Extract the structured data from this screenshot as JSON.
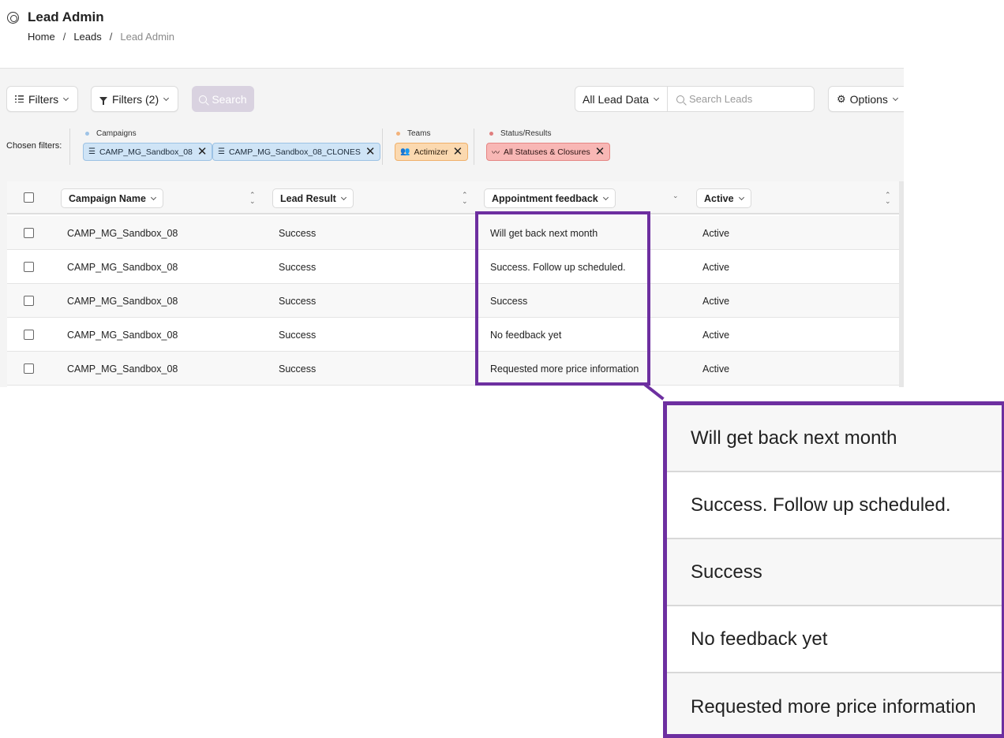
{
  "header": {
    "title": "Lead Admin",
    "breadcrumb": [
      "Home",
      "Leads",
      "Lead Admin"
    ],
    "breadcrumb_separator": "/"
  },
  "toolbar": {
    "filters_label": "Filters",
    "filters_count_label": "Filters (2)",
    "search_button_label": "Search",
    "data_scope_label": "All Lead Data",
    "search_placeholder": "Search Leads",
    "options_label": "Options"
  },
  "chosen_filters": {
    "label": "Chosen filters:",
    "groups": [
      {
        "title": "Campaigns",
        "dot_color": "#9ec3e6",
        "chips": [
          "CAMP_MG_Sandbox_08",
          "CAMP_MG_Sandbox_08_CLONES"
        ]
      },
      {
        "title": "Teams",
        "dot_color": "#f3b27a",
        "chips": [
          "Actimizer"
        ]
      },
      {
        "title": "Status/Results",
        "dot_color": "#e07d7d",
        "chips": [
          "All Statuses & Closures"
        ]
      }
    ]
  },
  "table": {
    "columns": [
      "Campaign Name",
      "Lead Result",
      "Appointment feedback",
      "Active"
    ],
    "rows": [
      [
        "CAMP_MG_Sandbox_08",
        "Success",
        "Will get back next month",
        "Active"
      ],
      [
        "CAMP_MG_Sandbox_08",
        "Success",
        "Success. Follow up scheduled.",
        "Active"
      ],
      [
        "CAMP_MG_Sandbox_08",
        "Success",
        "Success",
        "Active"
      ],
      [
        "CAMP_MG_Sandbox_08",
        "Success",
        "No feedback yet",
        "Active"
      ],
      [
        "CAMP_MG_Sandbox_08",
        "Success",
        "Requested more price information",
        "Active"
      ]
    ]
  },
  "zoom": {
    "items": [
      "Will get back next month",
      "Success. Follow up scheduled.",
      "Success",
      "No feedback yet",
      "Requested more price information"
    ]
  },
  "colors": {
    "highlight": "#6d2fa0",
    "search_button": "#d9d2e0"
  }
}
